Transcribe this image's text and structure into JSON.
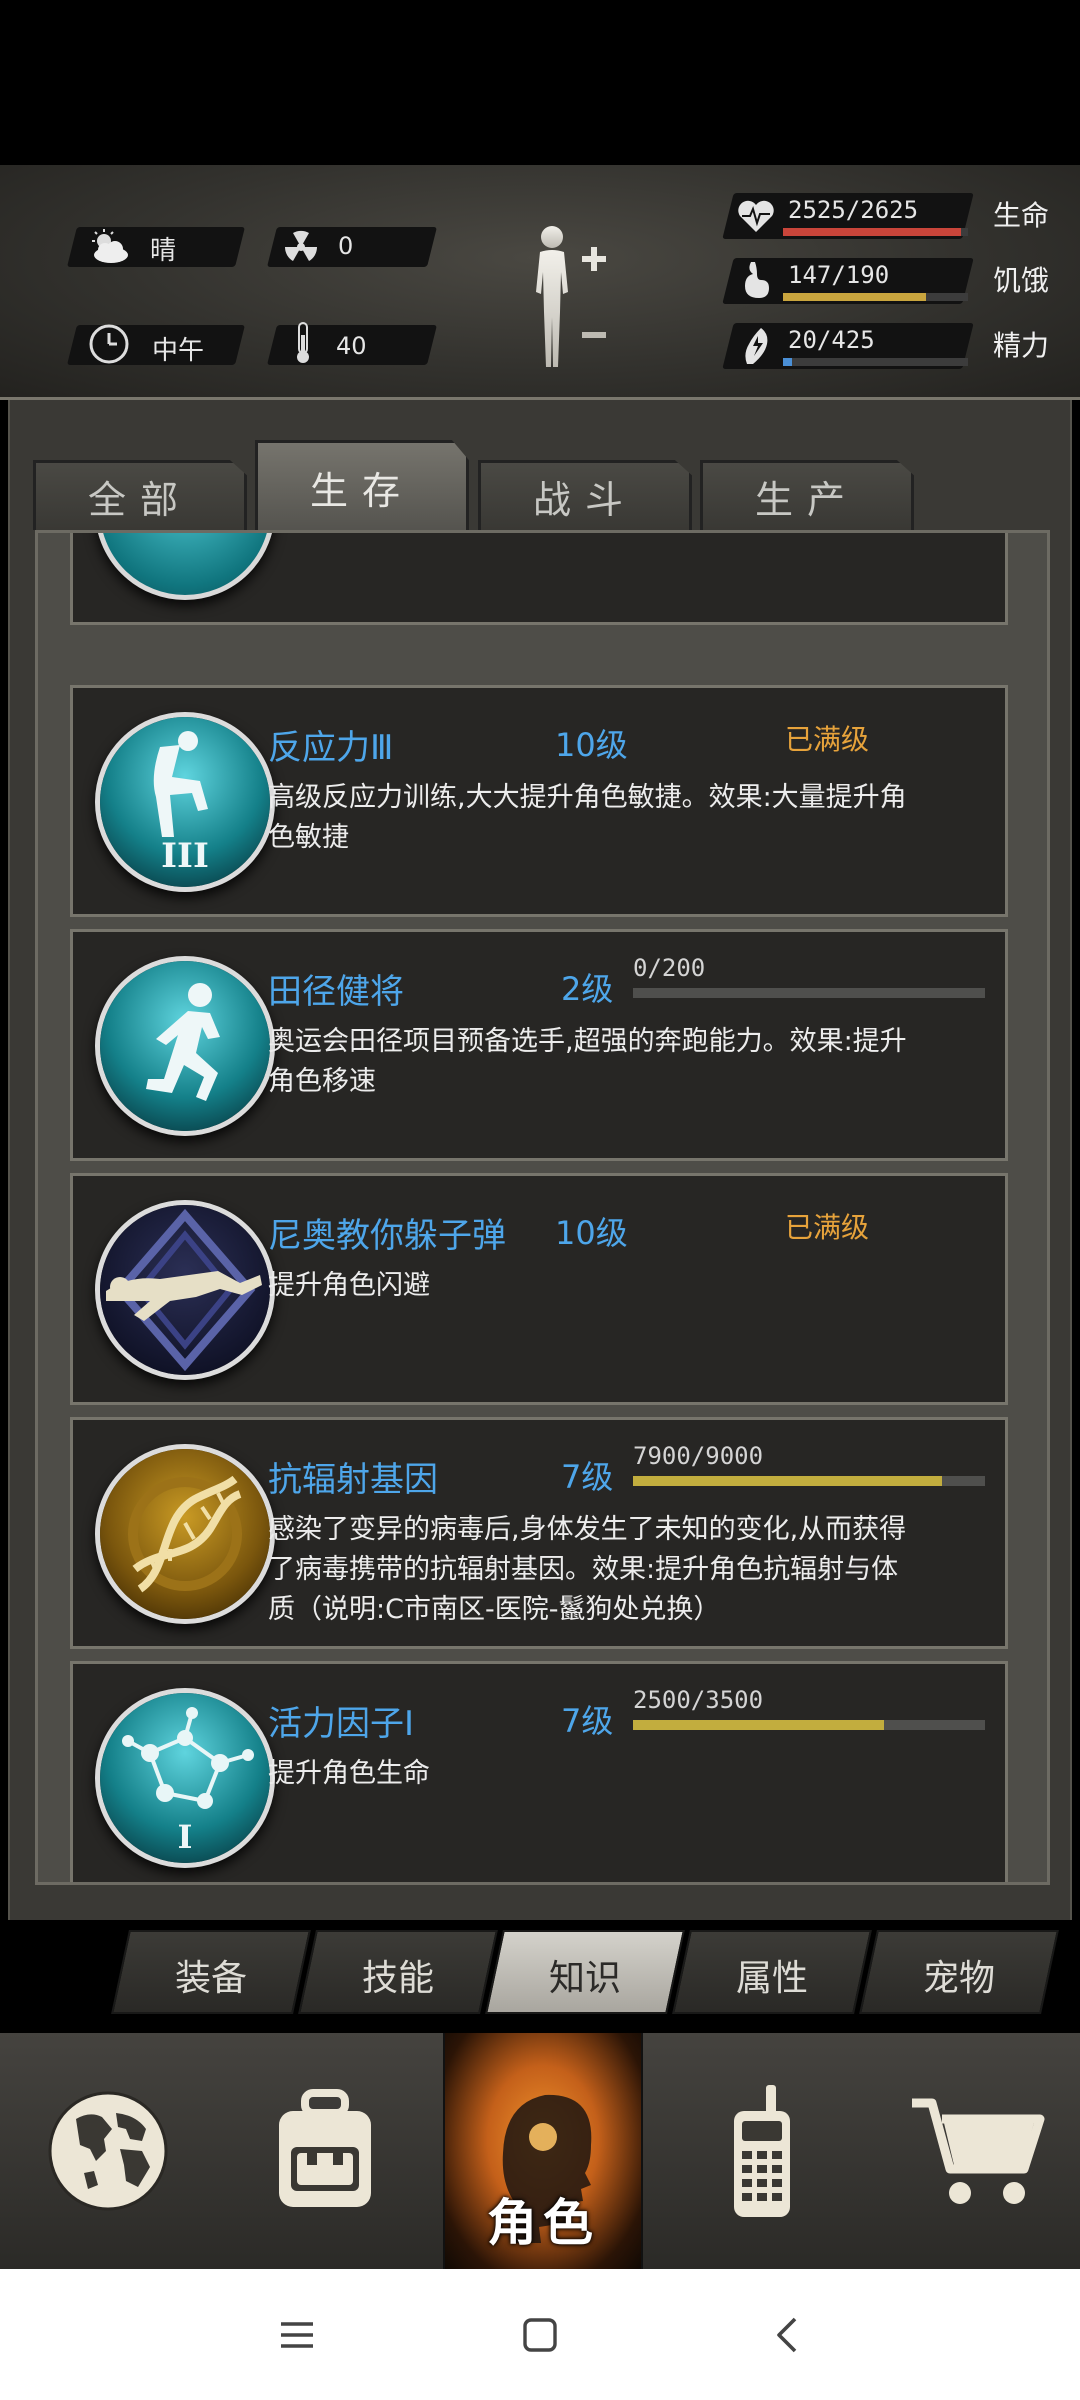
{
  "status": {
    "weather": {
      "icon": "cloud-sun-icon",
      "label": "晴"
    },
    "radiation": {
      "icon": "radiation-icon",
      "value": "0"
    },
    "time": {
      "icon": "clock-icon",
      "label": "中午"
    },
    "temperature": {
      "icon": "thermometer-icon",
      "value": "40"
    },
    "stats": [
      {
        "icon": "heart-pulse-icon",
        "value": "2525/2625",
        "label": "生命",
        "fraction": 0.962,
        "color": "#c9453a"
      },
      {
        "icon": "stomach-icon",
        "value": "147/190",
        "label": "饥饿",
        "fraction": 0.774,
        "color": "#c9a53e"
      },
      {
        "icon": "energy-icon",
        "value": "20/425",
        "label": "精力",
        "fraction": 0.047,
        "color": "#4a8fd6"
      }
    ]
  },
  "tabs": [
    {
      "label": "全部",
      "active": false
    },
    {
      "label": "生存",
      "active": true
    },
    {
      "label": "战斗",
      "active": false
    },
    {
      "label": "生产",
      "active": false
    }
  ],
  "skills": [
    {
      "name": "反应力Ⅲ",
      "level": "10级",
      "max_text": "已满级",
      "desc": "高级反应力训练,大大提升角色敏捷。效果:大量提升角色敏捷",
      "icon": "reflex-badge-icon"
    },
    {
      "name": "田径健将",
      "level": "2级",
      "xp_text": "0/200",
      "xp_fraction": 0.0,
      "desc": "奥运会田径项目预备选手,超强的奔跑能力。效果:提升角色移速",
      "icon": "runner-badge-icon"
    },
    {
      "name": "尼奥教你躲子弹",
      "level": "10级",
      "max_text": "已满级",
      "desc": "提升角色闪避",
      "icon": "dodge-badge-icon"
    },
    {
      "name": "抗辐射基因",
      "level": "7级",
      "xp_text": "7900/9000",
      "xp_fraction": 0.878,
      "desc": "感染了变异的病毒后,身体发生了未知的变化,从而获得了病毒携带的抗辐射基因。效果:提升角色抗辐射与体质（说明:C市南区-医院-鬣狗处兑换）",
      "icon": "dna-badge-icon"
    },
    {
      "name": "活力因子Ⅰ",
      "level": "7级",
      "xp_text": "2500/3500",
      "xp_fraction": 0.714,
      "desc": "提升角色生命",
      "icon": "molecule-badge-icon"
    }
  ],
  "subtabs": [
    {
      "label": "装备",
      "active": false
    },
    {
      "label": "技能",
      "active": false
    },
    {
      "label": "知识",
      "active": true
    },
    {
      "label": "属性",
      "active": false
    },
    {
      "label": "宠物",
      "active": false
    }
  ],
  "nav": {
    "world": {
      "icon": "globe-icon"
    },
    "backpack": {
      "icon": "backpack-icon"
    },
    "role": {
      "icon": "head-silhouette-icon",
      "label": "角色"
    },
    "radio": {
      "icon": "walkie-talkie-icon"
    },
    "shop": {
      "icon": "cart-icon"
    }
  },
  "system_nav": {
    "menu": {
      "icon": "menu-icon"
    },
    "home": {
      "icon": "home-square-icon"
    },
    "back": {
      "icon": "back-chevron-icon"
    }
  }
}
